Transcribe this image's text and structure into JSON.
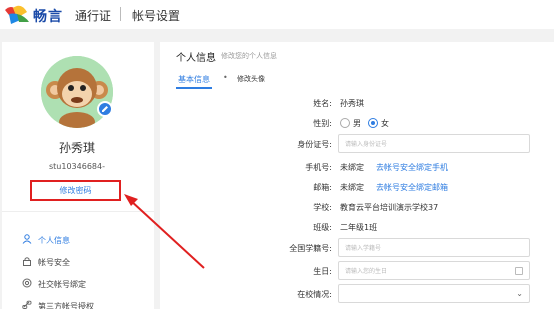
{
  "header": {
    "brand": "畅言",
    "pass_label": "通行证",
    "page_label": "帐号设置"
  },
  "profile": {
    "name": "孙秀琪",
    "user_id": "stu10346684-",
    "change_password": "修改密码"
  },
  "sidebar": {
    "items": [
      {
        "label": "个人信息",
        "icon": "person-icon",
        "active": true
      },
      {
        "label": "帐号安全",
        "icon": "lock-icon",
        "active": false
      },
      {
        "label": "社交帐号绑定",
        "icon": "at-icon",
        "active": false
      },
      {
        "label": "第三方帐号授权",
        "icon": "link-icon",
        "active": false
      }
    ]
  },
  "panel": {
    "title": "个人信息",
    "subtitle": "修改您的个人信息",
    "tabs": [
      "基本信息",
      "修改头像"
    ]
  },
  "form": {
    "name_label": "姓名:",
    "name_value": "孙秀琪",
    "gender_label": "性别:",
    "gender_male": "男",
    "gender_female": "女",
    "id_label": "身份证号:",
    "id_placeholder": "请输入身份证号",
    "phone_label": "手机号:",
    "phone_value": "未绑定",
    "phone_link": "去帐号安全绑定手机",
    "email_label": "邮箱:",
    "email_value": "未绑定",
    "email_link": "去帐号安全绑定邮箱",
    "school_label": "学校:",
    "school_value": "教育云平台培训演示学校37",
    "class_label": "班级:",
    "class_value": "二年级1班",
    "student_no_label": "全国学籍号:",
    "student_no_placeholder": "请输入学籍号",
    "birthday_label": "生日:",
    "birthday_placeholder": "请输入您的生日",
    "school_status_label": "在校情况:"
  },
  "colors": {
    "accent": "#2f7de1",
    "highlight_box": "#e02020",
    "brand": "#1a4aa8"
  }
}
